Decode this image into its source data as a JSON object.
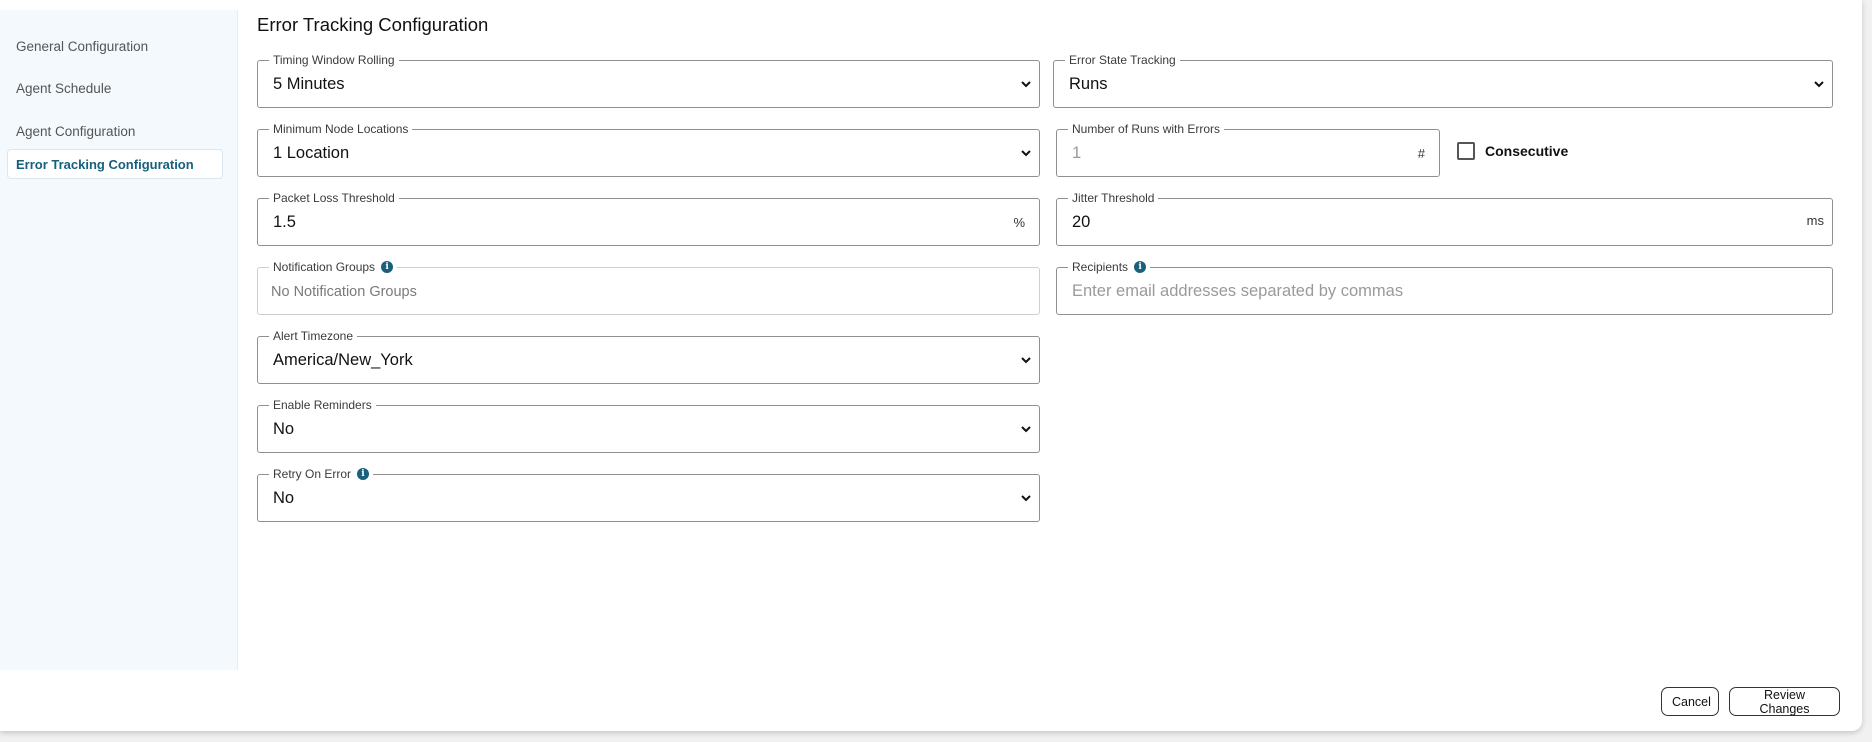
{
  "sidebar": {
    "items": [
      {
        "label": "General Configuration",
        "active": false
      },
      {
        "label": "Agent Schedule",
        "active": false
      },
      {
        "label": "Agent Configuration",
        "active": false
      },
      {
        "label": "Error Tracking Configuration",
        "active": true
      }
    ]
  },
  "page": {
    "title": "Error Tracking Configuration"
  },
  "fields": {
    "timing_window": {
      "label": "Timing Window Rolling",
      "value": "5 Minutes"
    },
    "error_state": {
      "label": "Error State Tracking",
      "value": "Runs"
    },
    "min_node_locations": {
      "label": "Minimum Node Locations",
      "value": "1 Location"
    },
    "runs_with_errors": {
      "label": "Number of Runs with Errors",
      "value": "1",
      "suffix": "#"
    },
    "consecutive": {
      "label": "Consecutive",
      "checked": false
    },
    "packet_loss": {
      "label": "Packet Loss Threshold",
      "value": "1.5",
      "suffix": "%"
    },
    "jitter": {
      "label": "Jitter Threshold",
      "value": "20",
      "suffix": "ms"
    },
    "notification_groups": {
      "label": "Notification Groups",
      "value": "No Notification Groups"
    },
    "recipients": {
      "label": "Recipients",
      "placeholder": "Enter email addresses separated by commas"
    },
    "alert_timezone": {
      "label": "Alert Timezone",
      "value": "America/New_York"
    },
    "enable_reminders": {
      "label": "Enable Reminders",
      "value": "No"
    },
    "retry_on_error": {
      "label": "Retry On Error",
      "value": "No"
    }
  },
  "footer": {
    "cancel_label": "Cancel",
    "review_label": "Review Changes"
  },
  "icons": {
    "info": "info-icon",
    "select_arrow": "chevron-down-icon"
  },
  "colors": {
    "accent": "#16607e",
    "sidebar_bg": "#f3f9fd",
    "info_icon": "#1a5f7d"
  }
}
